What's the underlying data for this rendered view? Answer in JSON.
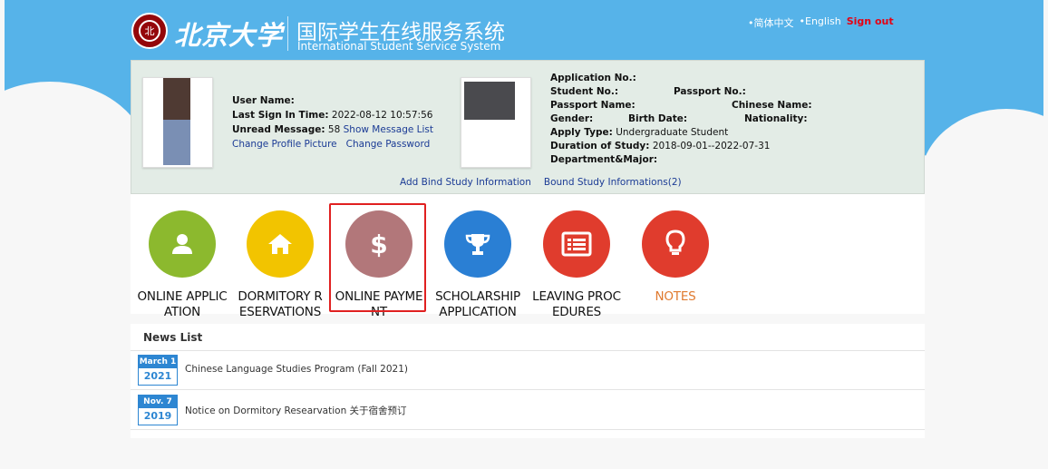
{
  "header": {
    "logo_text": "北京大学",
    "title_cn": "国际学生在线服务系统",
    "title_en": "International Student Service System",
    "lang_cn": "•简体中文",
    "lang_en": "•English",
    "signout": "Sign out"
  },
  "user": {
    "username_label": "User Name:",
    "last_sign_label": "Last Sign In Time:",
    "last_sign_value": "2022-08-12 10:57:56",
    "unread_label": "Unread Message:",
    "unread_value": "58",
    "show_messages": "Show Message List",
    "change_picture": "Change Profile Picture",
    "change_password": "Change Password"
  },
  "student": {
    "application_no": "Application No.:",
    "student_no": "Student No.:",
    "passport_no": "Passport No.:",
    "passport_name": "Passport Name:",
    "chinese_name": "Chinese Name:",
    "gender": "Gender:",
    "birth_date": "Birth Date:",
    "nationality": "Nationality:",
    "apply_type_label": "Apply Type:",
    "apply_type_value": "Undergraduate Student",
    "duration_label": "Duration of Study:",
    "duration_value": "2018-09-01--2022-07-31",
    "department": "Department&Major:"
  },
  "bind": {
    "add": "Add Bind Study Information",
    "bound": "Bound Study Informations(2)"
  },
  "tiles": [
    {
      "l1": "ONLINE APPLIC",
      "l2": "ATION",
      "color": "#8cb92e",
      "icon": "person-icon"
    },
    {
      "l1": "DORMITORY R",
      "l2": "ESERVATIONS",
      "color": "#f2c400",
      "icon": "home-icon"
    },
    {
      "l1": "ONLINE PAYME",
      "l2": "NT",
      "color": "#b2777a",
      "icon": "dollar-icon"
    },
    {
      "l1": "SCHOLARSHIP",
      "l2": "APPLICATION",
      "color": "#2a7fd4",
      "icon": "trophy-icon"
    },
    {
      "l1": "LEAVING PROC",
      "l2": "EDURES",
      "color": "#e03c2d",
      "icon": "list-icon"
    },
    {
      "l1": "NOTES",
      "l2": "",
      "color": "#e03c2d",
      "icon": "lightbulb-icon"
    }
  ],
  "news": {
    "title": "News List",
    "items": [
      {
        "month": "March 1",
        "year": "2021",
        "text": "Chinese Language Studies Program (Fall 2021)"
      },
      {
        "month": "Nov. 7",
        "year": "2019",
        "text": "Notice on Dormitory Researvation 关于宿舍预订"
      }
    ]
  }
}
